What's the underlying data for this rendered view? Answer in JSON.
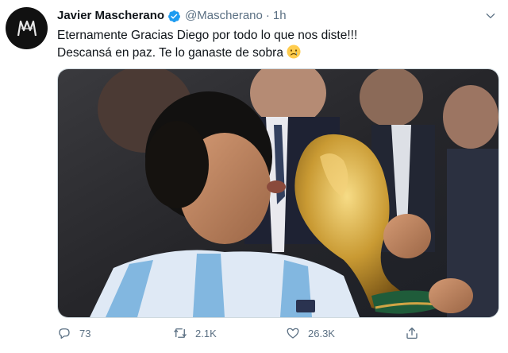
{
  "author": {
    "avatar_text": "M",
    "display_name": "Javier Mascherano",
    "handle": "@Mascherano",
    "separator": "·",
    "time": "1h",
    "verified": true
  },
  "tweet": {
    "text_line1": "Eternamente Gracias Diego por todo lo que nos diste!!!",
    "text_line2": "Descansá en paz. Te lo ganaste de sobra",
    "emoji": "crying-face"
  },
  "media": {
    "image_kind": "photo"
  },
  "actions": {
    "replies": "73",
    "retweets": "2.1K",
    "likes": "26.3K"
  },
  "colors": {
    "text": "#0f1419",
    "secondary": "#5b7083",
    "verified": "#1d9bf0",
    "avatar_bg": "#111111"
  }
}
